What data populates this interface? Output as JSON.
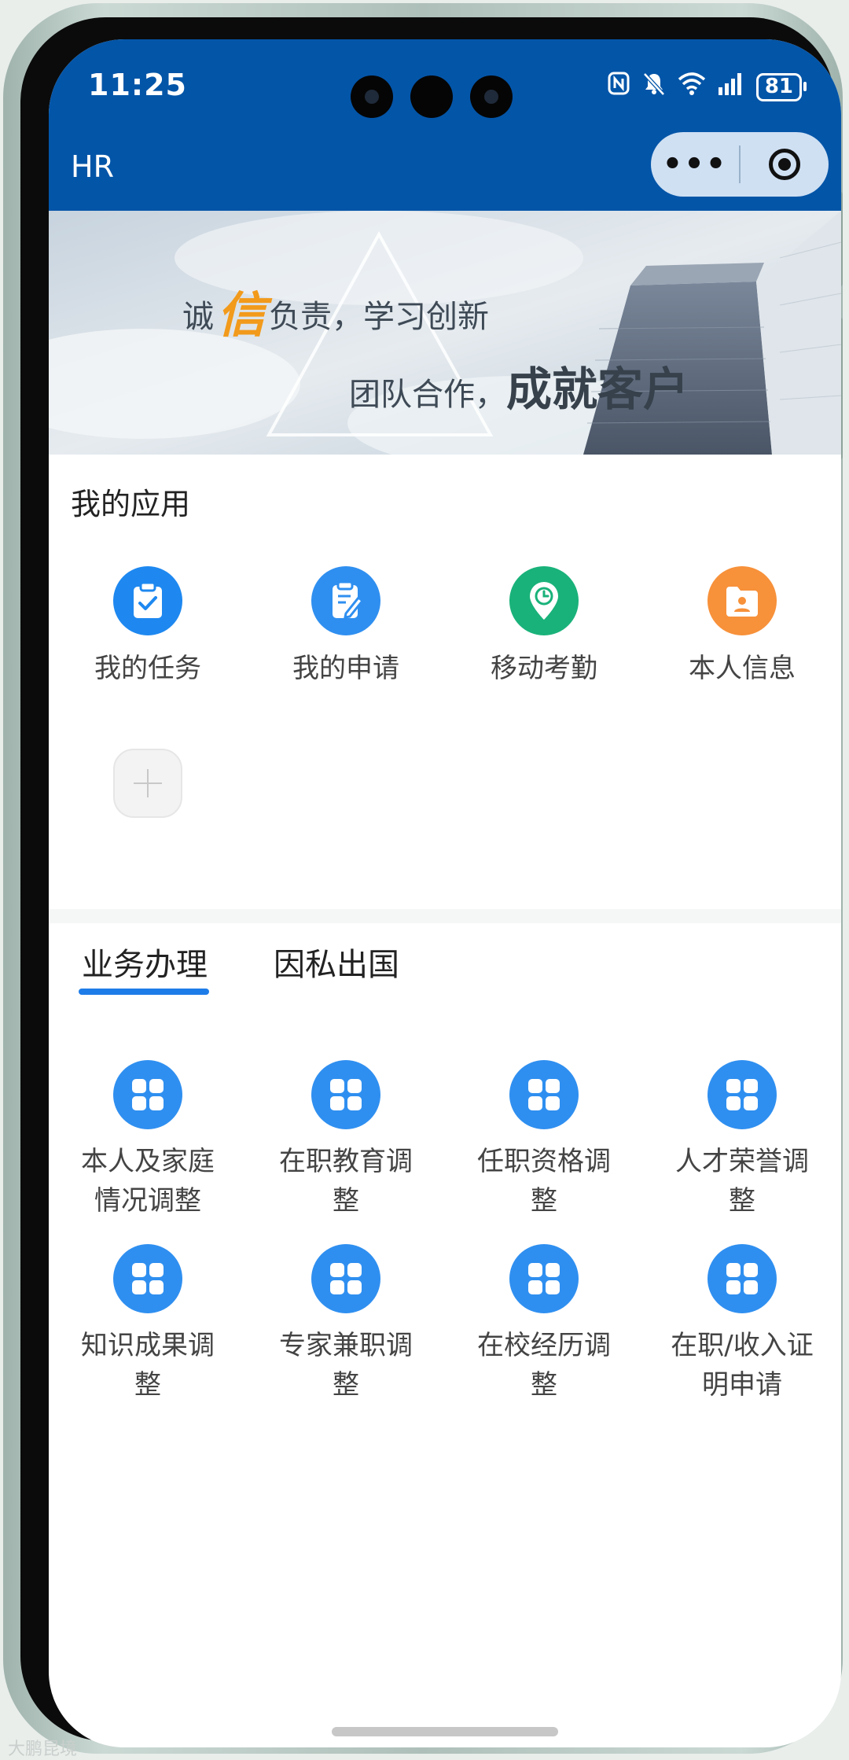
{
  "status_bar": {
    "time": "11:25",
    "battery": "81",
    "icons": [
      "nfc-icon",
      "mute-icon",
      "wifi-icon",
      "signal-icon",
      "battery-icon"
    ]
  },
  "nav": {
    "title": "HR",
    "more_icon": "more-dots-icon",
    "close_icon": "target-circle-icon"
  },
  "banner": {
    "line1_prefix": "诚",
    "line1_highlight": "信",
    "line1_suffix": "负责，学习创新",
    "line2_prefix": "团队合作，",
    "line2_emphasis": "成就客户"
  },
  "my_apps": {
    "title": "我的应用",
    "items": [
      {
        "label": "我的任务",
        "icon": "clipboard-check-icon",
        "color": "#1e88f0"
      },
      {
        "label": "我的申请",
        "icon": "edit-document-icon",
        "color": "#2f8ff0"
      },
      {
        "label": "移动考勤",
        "icon": "location-clock-icon",
        "color": "#19b27a"
      },
      {
        "label": "本人信息",
        "icon": "folder-person-icon",
        "color": "#f7913a"
      }
    ],
    "add_icon": "plus-icon"
  },
  "tabs": [
    {
      "label": "业务办理",
      "active": true
    },
    {
      "label": "因私出国",
      "active": false
    }
  ],
  "business": {
    "icon": "grid-four-icon",
    "icon_color": "#2f8ff0",
    "items": [
      {
        "label": "本人及家庭情况调整"
      },
      {
        "label": "在职教育调整"
      },
      {
        "label": "任职资格调整"
      },
      {
        "label": "人才荣誉调整"
      },
      {
        "label": "知识成果调整"
      },
      {
        "label": "专家兼职调整"
      },
      {
        "label": "在校经历调整"
      },
      {
        "label": "在职/收入证明申请"
      }
    ]
  },
  "watermark": "大鹏昆境"
}
